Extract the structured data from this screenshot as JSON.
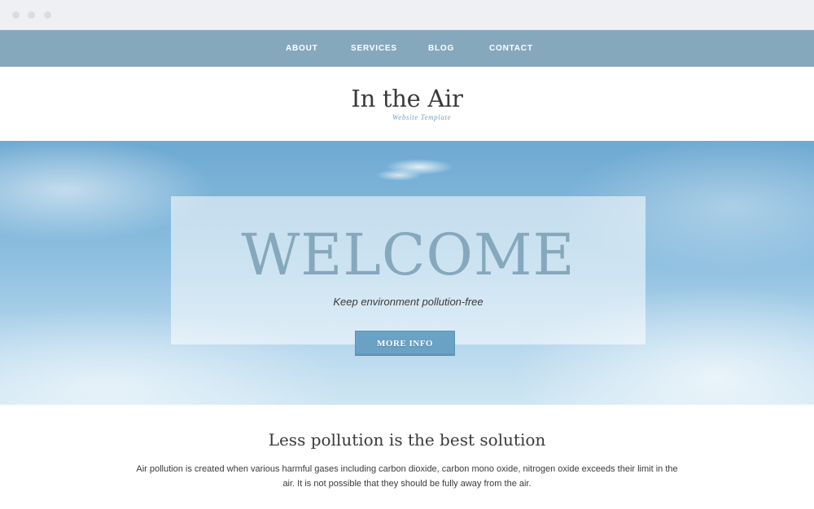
{
  "nav": {
    "items": [
      {
        "label": "ABOUT"
      },
      {
        "label": "SERVICES"
      },
      {
        "label": "BLOG"
      },
      {
        "label": "CONTACT"
      }
    ]
  },
  "logo": {
    "title": "In the Air",
    "subtitle": "Website Template"
  },
  "hero": {
    "title": "WELCOME",
    "tagline": "Keep environment pollution-free",
    "button_label": "MORE INFO"
  },
  "content": {
    "heading": "Less pollution is the best solution",
    "paragraph": "Air pollution is created when various harmful gases including carbon dioxide, carbon mono oxide, nitrogen oxide exceeds their limit in the air. It is not possible that they should be fully away from the air."
  },
  "colors": {
    "nav_bg": "#86a8bd",
    "accent": "#6aa2c6",
    "text": "#3a3a3a",
    "subtitle": "#7aa3bf"
  }
}
